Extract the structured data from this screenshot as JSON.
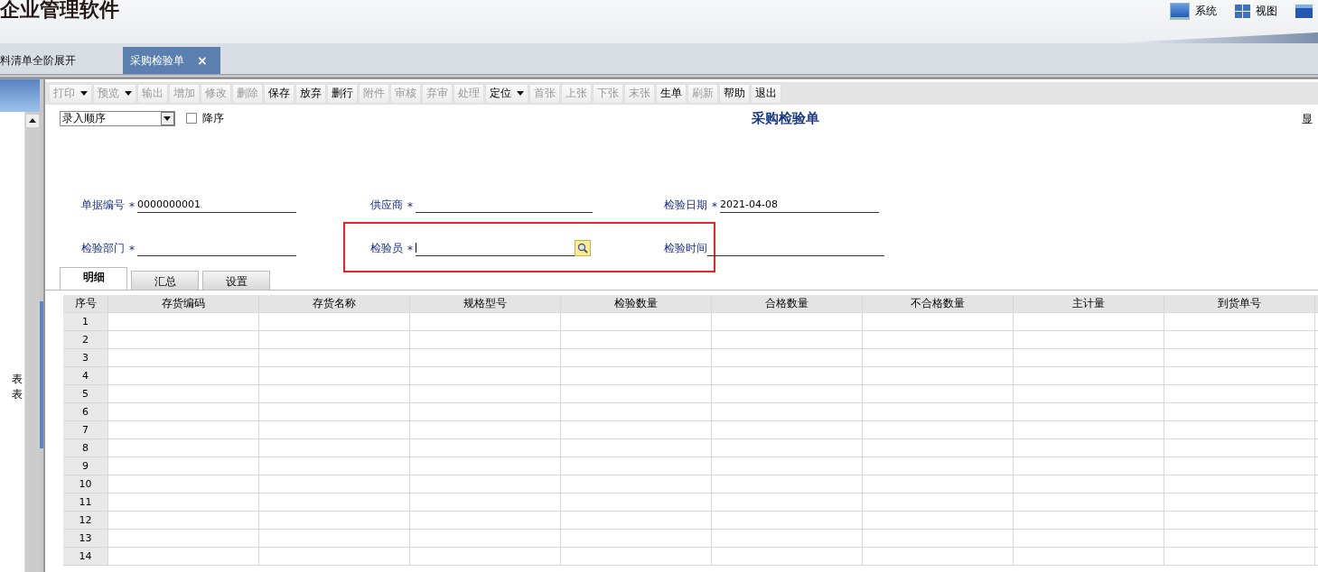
{
  "app": {
    "title": "企业管理软件",
    "menu": [
      {
        "kind": "monitor",
        "label": "系统"
      },
      {
        "kind": "grid",
        "label": "视图"
      },
      {
        "kind": "window"
      }
    ]
  },
  "tabs": [
    {
      "label": "料清单全阶展开",
      "selected": false,
      "closable": false
    },
    {
      "label": "采购检验单",
      "selected": true,
      "closable": true,
      "close": "×"
    }
  ],
  "sidebar": {
    "items": [
      "表",
      "表"
    ]
  },
  "toolbar": [
    {
      "label": "打印",
      "disabled": true,
      "dropdown": true
    },
    {
      "label": "预览",
      "disabled": true,
      "dropdown": true
    },
    {
      "label": "输出",
      "disabled": true,
      "dropdown": false
    },
    {
      "label": "增加",
      "disabled": true,
      "dropdown": false
    },
    {
      "label": "修改",
      "disabled": true,
      "dropdown": false
    },
    {
      "label": "删除",
      "disabled": true,
      "dropdown": false
    },
    {
      "label": "保存",
      "disabled": false,
      "dropdown": false
    },
    {
      "label": "放弃",
      "disabled": false,
      "dropdown": false
    },
    {
      "label": "删行",
      "disabled": false,
      "dropdown": false
    },
    {
      "label": "附件",
      "disabled": true,
      "dropdown": false
    },
    {
      "label": "审核",
      "disabled": true,
      "dropdown": false
    },
    {
      "label": "弃审",
      "disabled": true,
      "dropdown": false
    },
    {
      "label": "处理",
      "disabled": true,
      "dropdown": false
    },
    {
      "label": "定位",
      "disabled": false,
      "dropdown": true
    },
    {
      "label": "首张",
      "disabled": true,
      "dropdown": false
    },
    {
      "label": "上张",
      "disabled": true,
      "dropdown": false
    },
    {
      "label": "下张",
      "disabled": true,
      "dropdown": false
    },
    {
      "label": "末张",
      "disabled": true,
      "dropdown": false
    },
    {
      "label": "生单",
      "disabled": false,
      "dropdown": false
    },
    {
      "label": "刷新",
      "disabled": true,
      "dropdown": false
    },
    {
      "label": "帮助",
      "disabled": false,
      "dropdown": false
    },
    {
      "label": "退出",
      "disabled": false,
      "dropdown": false
    }
  ],
  "sort": {
    "value": "录入顺序",
    "descending": {
      "label": "降序",
      "checked": false
    }
  },
  "form": {
    "title": "采购检验单",
    "display_label": "显",
    "fields": [
      {
        "label": "单据编号",
        "required": true,
        "value": "0000000001",
        "lookup": false,
        "highlighted": false
      },
      {
        "label": "供应商",
        "required": true,
        "lookup": false,
        "highlighted": false
      },
      {
        "label": "检验日期",
        "required": true,
        "value": "2021-04-08",
        "lookup": false,
        "highlighted": false
      },
      {
        "label": "检验部门",
        "required": true,
        "lookup": false,
        "highlighted": false
      },
      {
        "label": "检验员",
        "required": true,
        "lookup": true,
        "highlighted": true
      },
      {
        "label": "检验时间",
        "required": false,
        "lookup": false,
        "highlighted": false
      }
    ],
    "required_mark": "*"
  },
  "detail_tabs": [
    {
      "label": "明细",
      "selected": true
    },
    {
      "label": "汇总",
      "selected": false
    },
    {
      "label": "设置",
      "selected": false
    }
  ],
  "table": {
    "columns": [
      "序号",
      "存货编码",
      "存货名称",
      "规格型号",
      "检验数量",
      "合格数量",
      "不合格数量",
      "主计量",
      "到货单号"
    ],
    "rows": [
      "1",
      "2",
      "3",
      "4",
      "5",
      "6",
      "7",
      "8",
      "9",
      "10",
      "11",
      "12",
      "13",
      "14"
    ]
  }
}
